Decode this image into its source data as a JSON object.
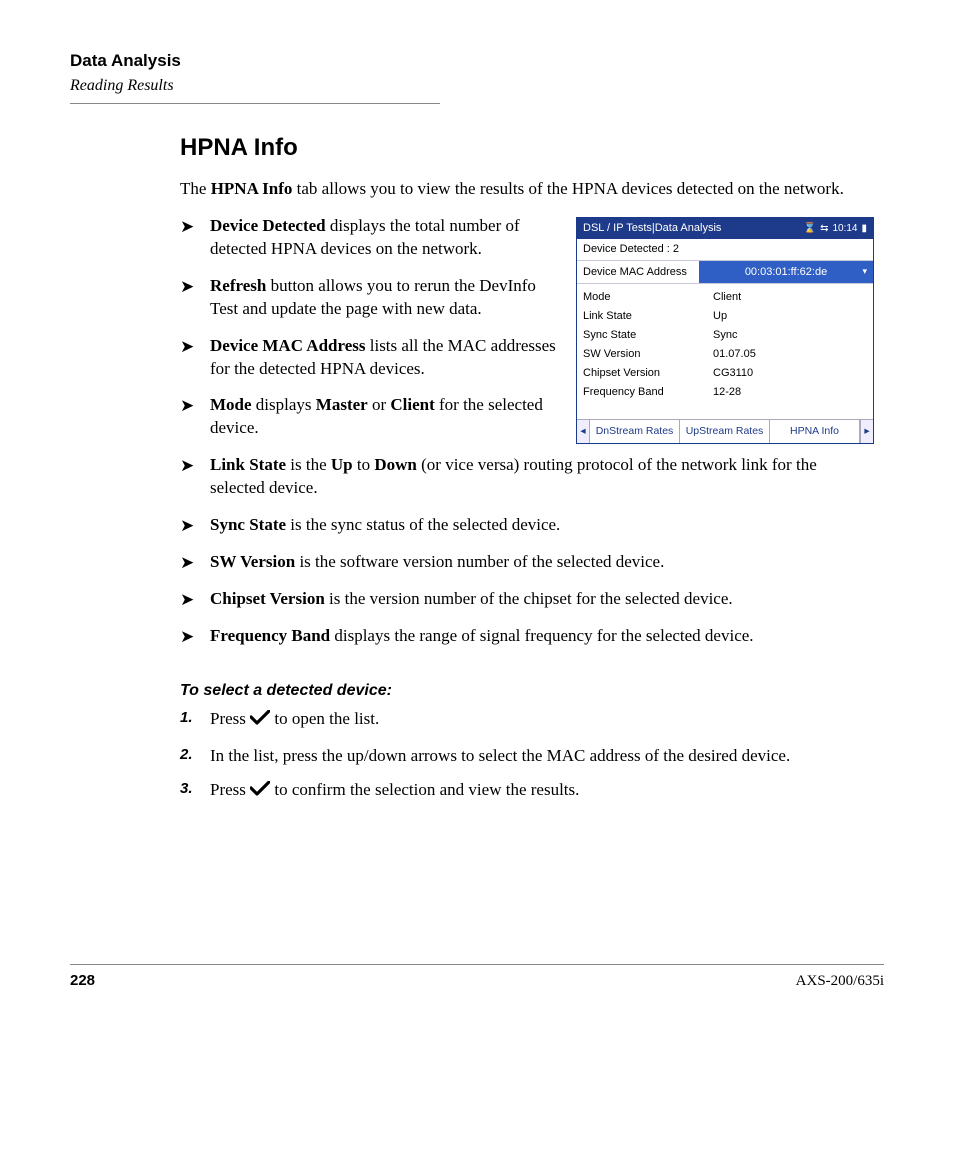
{
  "header": {
    "title": "Data Analysis",
    "subtitle": "Reading Results"
  },
  "section_heading": "HPNA Info",
  "intro_prefix": "The ",
  "intro_bold": "HPNA Info",
  "intro_suffix": " tab allows you to view the results of the HPNA devices detected on the network.",
  "screenshot": {
    "title": "DSL / IP Tests|Data Analysis",
    "time": "10:14",
    "detected_label": "Device Detected : 2",
    "mac_label": "Device MAC Address",
    "mac_value": "00:03:01:ff:62:de",
    "rows": [
      {
        "k": "Mode",
        "v": "Client"
      },
      {
        "k": "Link State",
        "v": "Up"
      },
      {
        "k": "Sync State",
        "v": "Sync"
      },
      {
        "k": "SW Version",
        "v": "01.07.05"
      },
      {
        "k": "Chipset Version",
        "v": "CG3110"
      },
      {
        "k": "Frequency Band",
        "v": "12-28"
      }
    ],
    "tabs": [
      "DnStream Rates",
      "UpStream Rates",
      "HPNA Info"
    ]
  },
  "bullets": [
    {
      "bold": "Device Detected",
      "text": " displays the total number of detected HPNA devices on the network."
    },
    {
      "bold": "Refresh",
      "text": " button allows you to rerun the DevInfo Test and update the page with new data."
    },
    {
      "bold": "Device MAC Address",
      "text": " lists all the MAC addresses for the detected HPNA devices."
    },
    {
      "bold": "Mode",
      "mid": " displays ",
      "b2": "Master",
      "mid2": " or ",
      "b3": "Client",
      "text": " for the selected device."
    },
    {
      "bold": "Link State",
      "mid": " is the ",
      "b2": "Up",
      "mid2": " to ",
      "b3": "Down",
      "text": " (or vice versa) routing protocol of the network link for the selected device."
    },
    {
      "bold": "Sync State",
      "text": " is the sync status of the selected device."
    },
    {
      "bold": "SW Version",
      "text": " is the software version number of the selected device."
    },
    {
      "bold": "Chipset Version",
      "text": " is the version number of the chipset for the selected device."
    },
    {
      "bold": "Frequency Band",
      "text": " displays the range of signal frequency for the selected device."
    }
  ],
  "subhead": "To select a detected device:",
  "steps": [
    {
      "pre": "Press ",
      "icon": true,
      "post": " to open the list."
    },
    {
      "pre": "In the list, press the up/down arrows to select the MAC address of the desired device.",
      "icon": false,
      "post": ""
    },
    {
      "pre": "Press ",
      "icon": true,
      "post": " to confirm the selection and view the results."
    }
  ],
  "footer": {
    "page": "228",
    "model": "AXS-200/635i"
  }
}
